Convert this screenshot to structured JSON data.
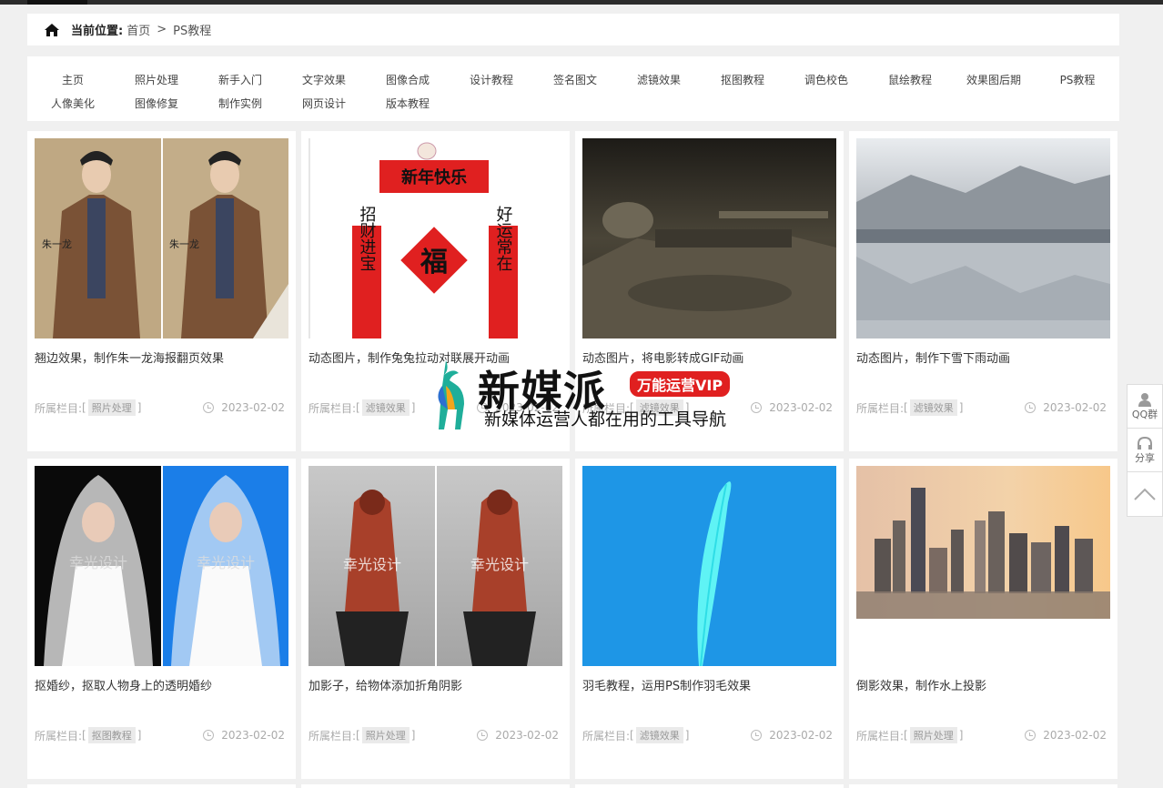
{
  "breadcrumb": {
    "label": "当前位置:",
    "home": "首页",
    "separator": ">",
    "current": "PS教程"
  },
  "nav": {
    "row1": [
      "主页",
      "照片处理",
      "新手入门",
      "文字效果",
      "图像合成",
      "设计教程",
      "签名图文",
      "滤镜效果",
      "抠图教程",
      "调色校色",
      "鼠绘教程",
      "效果图后期",
      "PS教程"
    ],
    "row2": [
      "人像美化",
      "图像修复",
      "制作实例",
      "网页设计",
      "版本教程"
    ]
  },
  "cards": [
    {
      "title": "翘边效果，制作朱一龙海报翻页效果",
      "category_label": "所属栏目:",
      "category": "照片处理",
      "date": "2023-02-02"
    },
    {
      "title": "动态图片，制作兔兔拉动对联展开动画",
      "category_label": "所属栏目:",
      "category": "滤镜效果",
      "date": "2023-02-02"
    },
    {
      "title": "动态图片，将电影转成GIF动画",
      "category_label": "所属栏目:",
      "category": "滤镜效果",
      "date": "2023-02-02"
    },
    {
      "title": "动态图片，制作下雪下雨动画",
      "category_label": "所属栏目:",
      "category": "滤镜效果",
      "date": "2023-02-02"
    },
    {
      "title": "抠婚纱，抠取人物身上的透明婚纱",
      "category_label": "所属栏目:",
      "category": "抠图教程",
      "date": "2023-02-02"
    },
    {
      "title": "加影子，给物体添加折角阴影",
      "category_label": "所属栏目:",
      "category": "照片处理",
      "date": "2023-02-02"
    },
    {
      "title": "羽毛教程，运用PS制作羽毛效果",
      "category_label": "所属栏目:",
      "category": "滤镜效果",
      "date": "2023-02-02"
    },
    {
      "title": "倒影效果，制作水上投影",
      "category_label": "所属栏目:",
      "category": "照片处理",
      "date": "2023-02-02"
    }
  ],
  "thumb_text": {
    "card1_side_text": "朱一龙",
    "card1_side_text2": "朱一龙",
    "couplet_top": "新年快乐",
    "couplet_left": "招财进宝",
    "couplet_right": "好运常在",
    "couplet_center": "福",
    "wedding_watermark1": "幸光设计",
    "wedding_watermark2": "幸光设计",
    "statue_watermark1": "幸光设计",
    "statue_watermark2": "幸光设计"
  },
  "side_buttons": {
    "qq": "QQ群",
    "share": "分享"
  },
  "watermark": {
    "title": "新媒派",
    "badge": "万能运营VIP",
    "subtitle": "新媒体运营人都在用的工具导航"
  },
  "colors": {
    "page_bg": "#f0f0f0",
    "card_bg": "#ffffff",
    "accent_red": "#e02020",
    "feather_bg": "#1e96e6"
  }
}
